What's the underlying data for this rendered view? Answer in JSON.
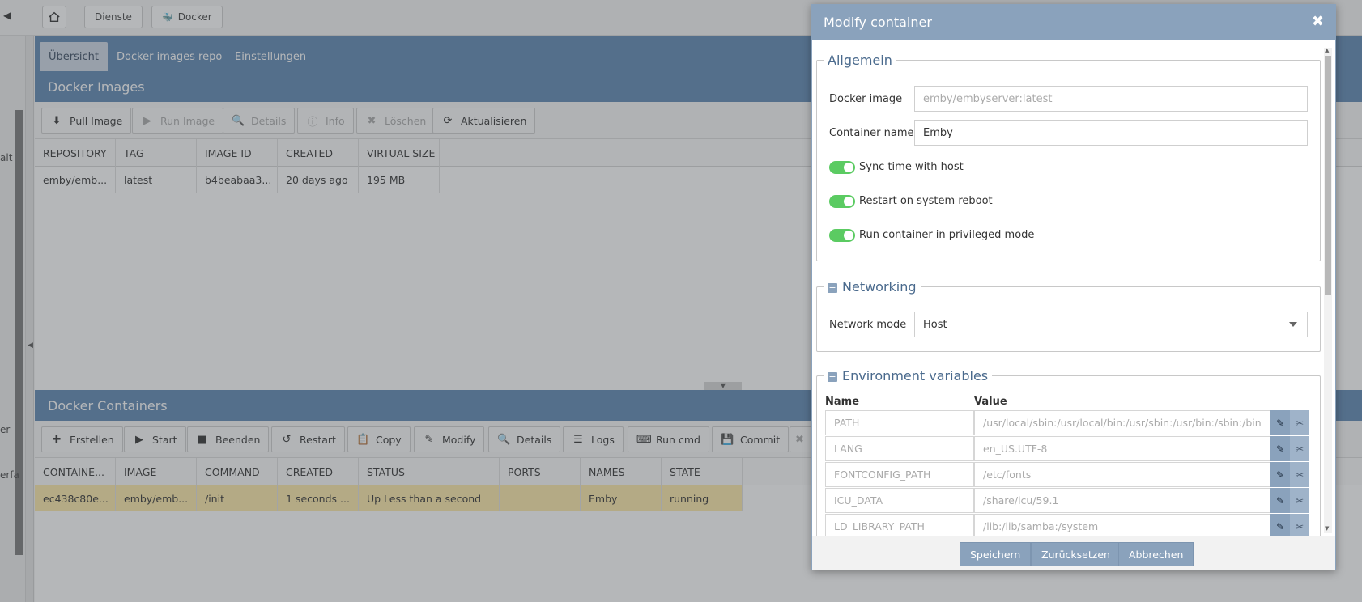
{
  "topbar": {
    "back_label": "◀",
    "crumbs": [
      "Dienste",
      "Docker"
    ]
  },
  "leftnav": {
    "cut_labels": [
      "alt",
      "er",
      "erfa"
    ]
  },
  "tabs": [
    "Übersicht",
    "Docker images repo",
    "Einstellungen"
  ],
  "images_panel": {
    "title": "Docker Images",
    "toolbar": [
      {
        "label": "Pull Image",
        "icon": "download-icon",
        "enabled": true
      },
      {
        "label": "Run Image",
        "icon": "play-icon",
        "enabled": false
      },
      {
        "label": "Details",
        "icon": "search-icon",
        "enabled": false
      },
      {
        "label": "Info",
        "icon": "info-icon",
        "enabled": false
      },
      {
        "label": "Löschen",
        "icon": "close-icon",
        "enabled": false
      },
      {
        "label": "Aktualisieren",
        "icon": "refresh-icon",
        "enabled": true
      }
    ],
    "columns": [
      "REPOSITORY",
      "TAG",
      "IMAGE ID",
      "CREATED",
      "VIRTUAL SIZE"
    ],
    "rows": [
      [
        "emby/emb...",
        "latest",
        "b4beabaa3...",
        "20 days ago",
        "195 MB"
      ]
    ]
  },
  "containers_panel": {
    "title": "Docker Containers",
    "toolbar": [
      {
        "label": "Erstellen",
        "icon": "plus-icon"
      },
      {
        "label": "Start",
        "icon": "play-icon"
      },
      {
        "label": "Beenden",
        "icon": "stop-icon"
      },
      {
        "label": "Restart",
        "icon": "undo-icon"
      },
      {
        "label": "Copy",
        "icon": "copy-icon"
      },
      {
        "label": "Modify",
        "icon": "edit-icon"
      },
      {
        "label": "Details",
        "icon": "search-icon"
      },
      {
        "label": "Logs",
        "icon": "list-icon"
      },
      {
        "label": "Run cmd",
        "icon": "terminal-icon"
      },
      {
        "label": "Commit",
        "icon": "save-icon"
      }
    ],
    "columns": [
      "CONTAINE...",
      "IMAGE",
      "COMMAND",
      "CREATED",
      "STATUS",
      "PORTS",
      "NAMES",
      "STATE"
    ],
    "rows": [
      [
        "ec438c80e...",
        "emby/emb...",
        "/init",
        "1 seconds ...",
        "Up Less than a second",
        "",
        "Emby",
        "running"
      ]
    ]
  },
  "dialog": {
    "title": "Modify container",
    "general": {
      "legend": "Allgemein",
      "docker_image_label": "Docker image",
      "docker_image_value": "emby/embyserver:latest",
      "container_name_label": "Container name",
      "container_name_value": "Emby",
      "toggles": [
        {
          "label": "Sync time with host",
          "on": true
        },
        {
          "label": "Restart on system reboot",
          "on": true
        },
        {
          "label": "Run container in privileged mode",
          "on": true
        }
      ]
    },
    "networking": {
      "legend": "Networking",
      "network_mode_label": "Network mode",
      "network_mode_value": "Host"
    },
    "env": {
      "legend": "Environment variables",
      "name_header": "Name",
      "value_header": "Value",
      "rows": [
        {
          "name": "PATH",
          "value": "/usr/local/sbin:/usr/local/bin:/usr/sbin:/usr/bin:/sbin:/bin"
        },
        {
          "name": "LANG",
          "value": "en_US.UTF-8"
        },
        {
          "name": "FONTCONFIG_PATH",
          "value": "/etc/fonts"
        },
        {
          "name": "ICU_DATA",
          "value": "/share/icu/59.1"
        },
        {
          "name": "LD_LIBRARY_PATH",
          "value": "/lib:/lib/samba:/system"
        }
      ]
    },
    "buttons": {
      "save": "Speichern",
      "reset": "Zurücksetzen",
      "cancel": "Abbrechen"
    }
  }
}
